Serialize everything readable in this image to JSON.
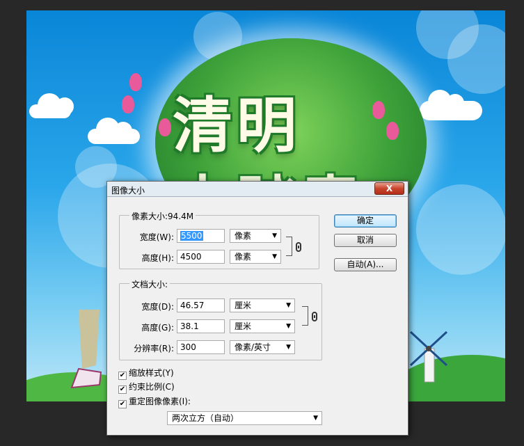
{
  "artwork": {
    "title_glyphs": "清明",
    "subtitle_glyphs": "去踏青"
  },
  "dialog": {
    "title": "图像大小",
    "close_label": "X",
    "pixel_group": {
      "title": "像素大小:94.4M",
      "width_label": "宽度(W):",
      "width_value": "5500",
      "width_unit": "像素",
      "height_label": "高度(H):",
      "height_value": "4500",
      "height_unit": "像素"
    },
    "doc_group": {
      "title": "文档大小:",
      "width_label": "宽度(D):",
      "width_value": "46.57",
      "width_unit": "厘米",
      "height_label": "高度(G):",
      "height_value": "38.1",
      "height_unit": "厘米",
      "res_label": "分辨率(R):",
      "res_value": "300",
      "res_unit": "像素/英寸"
    },
    "buttons": {
      "ok": "确定",
      "cancel": "取消",
      "auto": "自动(A)..."
    },
    "checkboxes": {
      "scale_styles": "缩放样式(Y)",
      "constrain": "约束比例(C)",
      "resample": "重定图像像素(I):"
    },
    "resample_method": "两次立方（自动）"
  },
  "colors": {
    "sky": "#2aa6ea",
    "leaf_green": "#3ea23a",
    "close_red": "#c8442c",
    "selection": "#3399ff"
  }
}
